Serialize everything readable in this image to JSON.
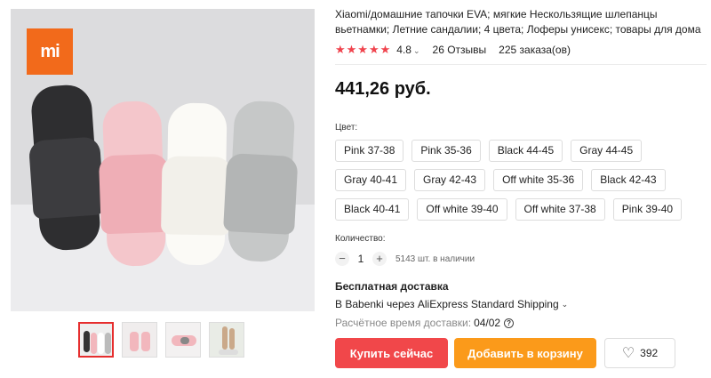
{
  "gallery": {
    "logo_text": "mi",
    "thumbnails": [
      {
        "name": "thumb-1",
        "active": true
      },
      {
        "name": "thumb-2",
        "active": false
      },
      {
        "name": "thumb-3",
        "active": false
      },
      {
        "name": "thumb-4",
        "active": false
      }
    ],
    "colors": {
      "black": "#3a3a3c",
      "pink": "#f2b7bd",
      "white": "#f7f6f2",
      "gray": "#b9bbbb",
      "brand": "#f26a1b"
    }
  },
  "product": {
    "title": "Xiaomi/домашние тапочки EVA; мягкие Нескользящие шлепанцы вьетнамки; Летние сандалии; 4 цвета; Лоферы унисекс; товары для дома",
    "stars": "★★★★★",
    "rating": "4.8",
    "reviews": "26 Отзывы",
    "orders": "225 заказа(ов)",
    "price": "441,26 руб."
  },
  "color": {
    "label": "Цвет:",
    "options": [
      "Pink 37-38",
      "Pink 35-36",
      "Black 44-45",
      "Gray 44-45",
      "Gray 40-41",
      "Gray 42-43",
      "Off white 35-36",
      "Black 42-43",
      "Black 40-41",
      "Off white 39-40",
      "Off white 37-38",
      "Pink 39-40"
    ]
  },
  "quantity": {
    "label": "Количество:",
    "minus": "−",
    "value": "1",
    "plus": "+",
    "stock": "5143 шт. в наличии"
  },
  "shipping": {
    "title": "Бесплатная доставка",
    "line": "В Babenki через AliExpress Standard Shipping",
    "eta_label": "Расчётное время доставки:",
    "eta_value": "04/02",
    "help": "?"
  },
  "actions": {
    "buy": "Купить сейчас",
    "cart": "Добавить в корзину",
    "wishlist_count": "392"
  },
  "accent": {
    "buy": "#f1474a",
    "cart": "#fb9a1a",
    "stars": "#f0434d"
  }
}
